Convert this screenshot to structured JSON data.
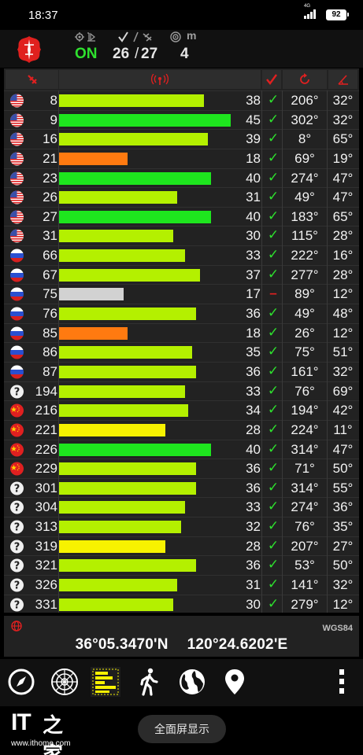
{
  "status_bar": {
    "time": "18:37",
    "network": "4G",
    "battery": "92"
  },
  "header": {
    "fix_status": "ON",
    "sats_used": "26",
    "sats_separator": "/",
    "sats_visible": "27",
    "accuracy": "4",
    "accuracy_unit": "m"
  },
  "satellites": [
    {
      "flag": "us",
      "prn": "8",
      "snr": "38",
      "used": true,
      "az": "206°",
      "el": "32°",
      "bar": "lime"
    },
    {
      "flag": "us",
      "prn": "9",
      "snr": "45",
      "used": true,
      "az": "302°",
      "el": "32°",
      "bar": "green"
    },
    {
      "flag": "us",
      "prn": "16",
      "snr": "39",
      "used": true,
      "az": "8°",
      "el": "65°",
      "bar": "lime"
    },
    {
      "flag": "us",
      "prn": "21",
      "snr": "18",
      "used": true,
      "az": "69°",
      "el": "19°",
      "bar": "orange"
    },
    {
      "flag": "us",
      "prn": "23",
      "snr": "40",
      "used": true,
      "az": "274°",
      "el": "47°",
      "bar": "green"
    },
    {
      "flag": "us",
      "prn": "26",
      "snr": "31",
      "used": true,
      "az": "49°",
      "el": "47°",
      "bar": "lime"
    },
    {
      "flag": "us",
      "prn": "27",
      "snr": "40",
      "used": true,
      "az": "183°",
      "el": "65°",
      "bar": "green"
    },
    {
      "flag": "us",
      "prn": "31",
      "snr": "30",
      "used": true,
      "az": "115°",
      "el": "28°",
      "bar": "lime"
    },
    {
      "flag": "ru",
      "prn": "66",
      "snr": "33",
      "used": true,
      "az": "222°",
      "el": "16°",
      "bar": "lime"
    },
    {
      "flag": "ru",
      "prn": "67",
      "snr": "37",
      "used": true,
      "az": "277°",
      "el": "28°",
      "bar": "lime"
    },
    {
      "flag": "ru",
      "prn": "75",
      "snr": "17",
      "used": false,
      "az": "89°",
      "el": "12°",
      "bar": "gray"
    },
    {
      "flag": "ru",
      "prn": "76",
      "snr": "36",
      "used": true,
      "az": "49°",
      "el": "48°",
      "bar": "lime"
    },
    {
      "flag": "ru",
      "prn": "85",
      "snr": "18",
      "used": true,
      "az": "26°",
      "el": "12°",
      "bar": "orange"
    },
    {
      "flag": "ru",
      "prn": "86",
      "snr": "35",
      "used": true,
      "az": "75°",
      "el": "51°",
      "bar": "lime"
    },
    {
      "flag": "ru",
      "prn": "87",
      "snr": "36",
      "used": true,
      "az": "161°",
      "el": "32°",
      "bar": "lime"
    },
    {
      "flag": "unknown",
      "prn": "194",
      "snr": "33",
      "used": true,
      "az": "76°",
      "el": "69°",
      "bar": "lime"
    },
    {
      "flag": "cn",
      "prn": "216",
      "snr": "34",
      "used": true,
      "az": "194°",
      "el": "42°",
      "bar": "lime"
    },
    {
      "flag": "cn",
      "prn": "221",
      "snr": "28",
      "used": true,
      "az": "224°",
      "el": "11°",
      "bar": "yellow"
    },
    {
      "flag": "cn",
      "prn": "226",
      "snr": "40",
      "used": true,
      "az": "314°",
      "el": "47°",
      "bar": "green"
    },
    {
      "flag": "cn",
      "prn": "229",
      "snr": "36",
      "used": true,
      "az": "71°",
      "el": "50°",
      "bar": "lime"
    },
    {
      "flag": "unknown",
      "prn": "301",
      "snr": "36",
      "used": true,
      "az": "314°",
      "el": "55°",
      "bar": "lime"
    },
    {
      "flag": "unknown",
      "prn": "304",
      "snr": "33",
      "used": true,
      "az": "274°",
      "el": "36°",
      "bar": "lime"
    },
    {
      "flag": "unknown",
      "prn": "313",
      "snr": "32",
      "used": true,
      "az": "76°",
      "el": "35°",
      "bar": "lime"
    },
    {
      "flag": "unknown",
      "prn": "319",
      "snr": "28",
      "used": true,
      "az": "207°",
      "el": "27°",
      "bar": "yellow"
    },
    {
      "flag": "unknown",
      "prn": "321",
      "snr": "36",
      "used": true,
      "az": "53°",
      "el": "50°",
      "bar": "lime"
    },
    {
      "flag": "unknown",
      "prn": "326",
      "snr": "31",
      "used": true,
      "az": "141°",
      "el": "32°",
      "bar": "lime"
    },
    {
      "flag": "unknown",
      "prn": "331",
      "snr": "30",
      "used": true,
      "az": "279°",
      "el": "12°",
      "bar": "lime"
    }
  ],
  "snr_max": 48,
  "colors": {
    "lime": "#b4f000",
    "green": "#1ee61e",
    "orange": "#ff7a10",
    "yellow": "#f7f200",
    "gray": "#d2d2d2",
    "accent_red": "#e02020",
    "used_check": "#2ee02e",
    "logo_red": "#e0201e"
  },
  "icons": {
    "header_fix": "gps-fix-icon",
    "header_sats": "satellite-check-icon",
    "header_accuracy": "target-icon",
    "col_prn": "satellite-icon",
    "col_snr": "signal-antenna-icon",
    "col_used": "check-icon",
    "col_az": "azimuth-rotate-icon",
    "col_el": "elevation-angle-icon"
  },
  "location": {
    "datum": "WGS84",
    "latitude": "36°05.3470'N",
    "longitude": "120°24.6202'E"
  },
  "toolbar": [
    "compass-icon",
    "radar-icon",
    "signal-bars-icon",
    "walk-icon",
    "globe-icon",
    "map-pin-icon",
    "more-vert-icon"
  ],
  "watermark": {
    "brand": "IT",
    "brand_cn": "之家",
    "url": "www.ithome.com"
  },
  "fullscreen_button": "全面屏显示"
}
